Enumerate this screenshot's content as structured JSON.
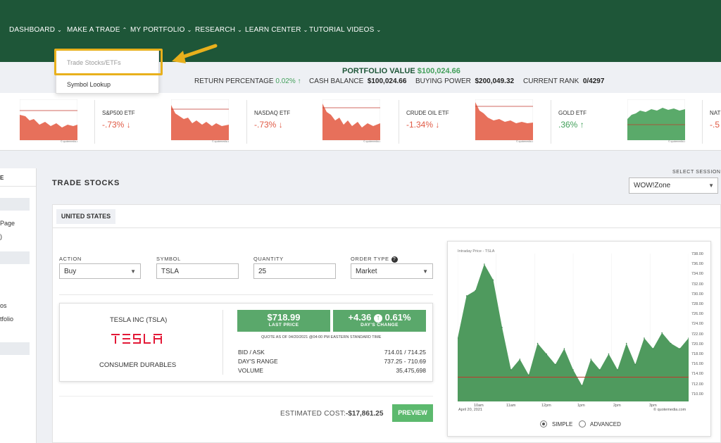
{
  "nav": {
    "items": [
      "DASHBOARD",
      "MAKE A TRADE",
      "MY PORTFOLIO",
      "RESEARCH",
      "LEARN CENTER",
      "TUTORIAL VIDEOS"
    ]
  },
  "dropdown": {
    "items": [
      "Trade Stocks/ETFs",
      "Symbol Lookup"
    ]
  },
  "portfolio": {
    "label": "PORTFOLIO VALUE",
    "value": "$100,024.66",
    "return_label": "RETURN PERCENTAGE",
    "return_value": "0.02%",
    "cash_label": "CASH BALANCE",
    "cash_value": "$100,024.66",
    "buying_label": "BUYING POWER",
    "buying_value": "$200,049.32",
    "rank_label": "CURRENT RANK",
    "rank_value": "0/4297"
  },
  "ticker": [
    {
      "name": "S&P500 ETF",
      "value": "-.73%",
      "dir": "down"
    },
    {
      "name": "NASDAQ ETF",
      "value": "-.73%",
      "dir": "down"
    },
    {
      "name": "CRUDE OIL ETF",
      "value": "-1.34%",
      "dir": "down"
    },
    {
      "name": "GOLD ETF",
      "value": ".36%",
      "dir": "up"
    },
    {
      "name": "NAT",
      "value": "-.5",
      "dir": "down"
    }
  ],
  "left_panel": {
    "t1": "E",
    "t2": "Page",
    "t3": ")",
    "t4": "os",
    "t5": "tfolio"
  },
  "trade": {
    "title": "TRADE STOCKS",
    "session_label": "SELECT SESSION",
    "session_value": "WOW!Zone",
    "tab": "UNITED STATES",
    "action_label": "ACTION",
    "action_value": "Buy",
    "symbol_label": "SYMBOL",
    "symbol_value": "TSLA",
    "quantity_label": "QUANTITY",
    "quantity_value": "25",
    "ordertype_label": "ORDER TYPE",
    "ordertype_value": "Market"
  },
  "quote": {
    "company": "TESLA INC (TSLA)",
    "logo_text": "TESLA",
    "sector": "CONSUMER DURABLES",
    "last_price": "$718.99",
    "last_price_label": "LAST PRICE",
    "change": "+4.36",
    "change_pct": "0.61%",
    "change_label": "DAY'S CHANGE",
    "asof": "QUOTE AS OF 04/20/2021 @04:00 PM EASTERN STANDARD TIME",
    "bid_ask_label": "BID / ASK",
    "bid_ask": "714.01 / 714.25",
    "range_label": "DAY'S RANGE",
    "range": "737.25 - 710.69",
    "volume_label": "VOLUME",
    "volume": "35,475,698"
  },
  "cost": {
    "label": "ESTIMATED COST:",
    "value": "-$17,861.25",
    "button": "PREVIEW"
  },
  "intraday": {
    "title": "Intraday Price - TSLA",
    "y_ticks": [
      "738.00",
      "736.00",
      "734.00",
      "732.00",
      "730.00",
      "728.00",
      "726.00",
      "724.00",
      "722.00",
      "720.00",
      "718.00",
      "716.00",
      "714.00",
      "712.00",
      "710.00"
    ],
    "x_ticks": [
      "10am",
      "11am",
      "12pm",
      "1pm",
      "2pm",
      "3pm"
    ],
    "date": "April 20, 2021",
    "source": "© quotemedia.com",
    "simple_label": "SIMPLE",
    "advanced_label": "ADVANCED"
  },
  "chart_data": {
    "type": "area",
    "title": "Intraday Price - TSLA",
    "x": [
      "9:30",
      "9:45",
      "10:00",
      "10:15",
      "10:30",
      "10:45",
      "11:00",
      "11:15",
      "11:30",
      "11:45",
      "12:00",
      "12:15",
      "12:30",
      "12:45",
      "13:00",
      "13:15",
      "13:30",
      "13:45",
      "14:00",
      "14:15",
      "14:30",
      "14:45",
      "15:00",
      "15:15",
      "15:30",
      "15:45",
      "16:00"
    ],
    "values": [
      722,
      730,
      731,
      736,
      733,
      724,
      716,
      718,
      715,
      721,
      719,
      717,
      720,
      716,
      713,
      718,
      716,
      719,
      716,
      721,
      717,
      722,
      720,
      723,
      721,
      720,
      722
    ],
    "reference_line": 714.6,
    "ylim": [
      710,
      738
    ],
    "colors": {
      "area": "#4f9a5e",
      "reference": "#c0392b"
    }
  },
  "colors": {
    "nav_bg": "#1e5638",
    "accent_green": "#43a05b",
    "loss_red": "#e05a45",
    "highlight": "#e8b01c"
  }
}
